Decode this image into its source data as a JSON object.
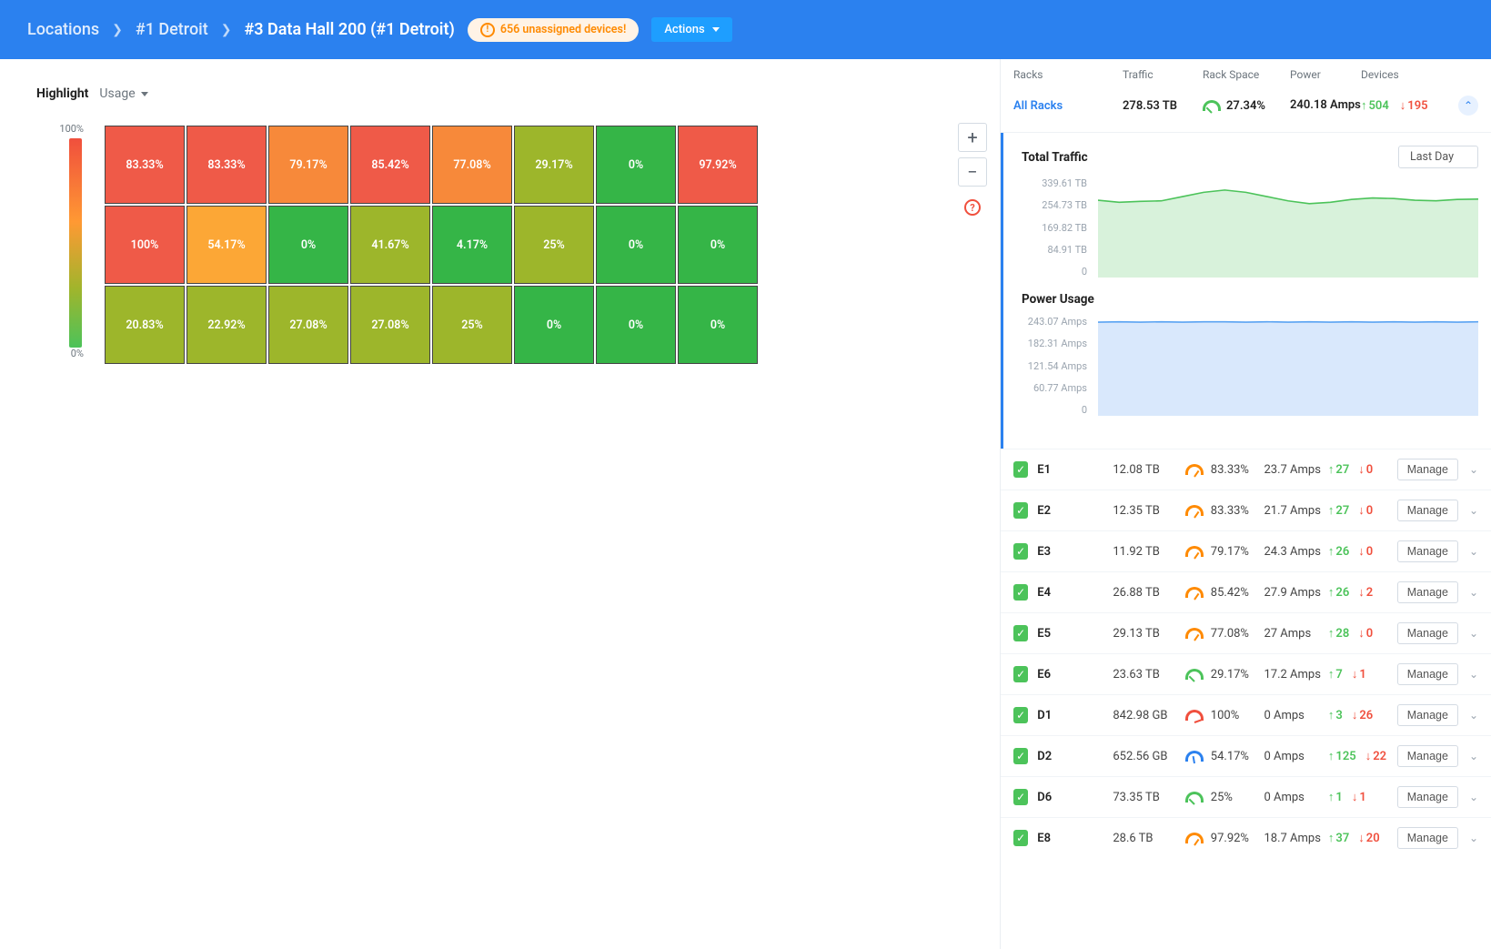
{
  "header": {
    "breadcrumbs": {
      "root": "Locations",
      "l1": "#1 Detroit",
      "current": "#3 Data Hall 200 (#1 Detroit)"
    },
    "unassigned_pill": "656 unassigned devices!",
    "actions_label": "Actions"
  },
  "highlight": {
    "label": "Highlight",
    "selected": "Usage"
  },
  "legend": {
    "top": "100%",
    "bottom": "0%"
  },
  "grid": [
    [
      {
        "v": "83.33%",
        "c": "#ef5a48"
      },
      {
        "v": "83.33%",
        "c": "#ef5a48"
      },
      {
        "v": "79.17%",
        "c": "#f7893a"
      },
      {
        "v": "85.42%",
        "c": "#ef5a48"
      },
      {
        "v": "77.08%",
        "c": "#f7893a"
      },
      {
        "v": "29.17%",
        "c": "#9db62b"
      },
      {
        "v": "0%",
        "c": "#35b547"
      },
      {
        "v": "97.92%",
        "c": "#ef5a48"
      }
    ],
    [
      {
        "v": "100%",
        "c": "#ef5a48"
      },
      {
        "v": "54.17%",
        "c": "#fca736"
      },
      {
        "v": "0%",
        "c": "#35b547"
      },
      {
        "v": "41.67%",
        "c": "#9db62b"
      },
      {
        "v": "4.17%",
        "c": "#35b547"
      },
      {
        "v": "25%",
        "c": "#9db62b"
      },
      {
        "v": "0%",
        "c": "#35b547"
      },
      {
        "v": "0%",
        "c": "#35b547"
      }
    ],
    [
      {
        "v": "20.83%",
        "c": "#9db62b"
      },
      {
        "v": "22.92%",
        "c": "#9db62b"
      },
      {
        "v": "27.08%",
        "c": "#9db62b"
      },
      {
        "v": "27.08%",
        "c": "#9db62b"
      },
      {
        "v": "25%",
        "c": "#9db62b"
      },
      {
        "v": "0%",
        "c": "#35b547"
      },
      {
        "v": "0%",
        "c": "#35b547"
      },
      {
        "v": "0%",
        "c": "#35b547"
      }
    ]
  ],
  "stat_headers": {
    "racks": "Racks",
    "traffic": "Traffic",
    "rack_space": "Rack Space",
    "power": "Power",
    "devices": "Devices"
  },
  "summary": {
    "label": "All Racks",
    "traffic": "278.53 TB",
    "space_pct": "27.34%",
    "power": "240.18 Amps",
    "dev_up": "504",
    "dev_down": "195"
  },
  "charts": {
    "traffic": {
      "title": "Total Traffic",
      "range": "Last Day",
      "ylabels": [
        "339.61 TB",
        "254.73 TB",
        "169.82 TB",
        "84.91 TB",
        "0"
      ]
    },
    "power": {
      "title": "Power Usage",
      "ylabels": [
        "243.07 Amps",
        "182.31 Amps",
        "121.54 Amps",
        "60.77 Amps",
        "0"
      ]
    }
  },
  "chart_data": [
    {
      "type": "area",
      "title": "Total Traffic",
      "xlabel": "",
      "ylabel": "",
      "ylim": [
        0,
        339.61
      ],
      "y_unit": "TB",
      "x_range_label": "Last Day",
      "values": [
        272,
        265,
        268,
        270,
        285,
        300,
        308,
        300,
        285,
        270,
        260,
        265,
        275,
        280,
        278,
        272,
        270,
        275,
        276
      ]
    },
    {
      "type": "area",
      "title": "Power Usage",
      "xlabel": "",
      "ylabel": "",
      "ylim": [
        0,
        243.07
      ],
      "y_unit": "Amps",
      "values": [
        236,
        237,
        236,
        237,
        236,
        237,
        237,
        236,
        237,
        236,
        237,
        236,
        237,
        236,
        237,
        236,
        237,
        236,
        237
      ]
    }
  ],
  "racks": [
    {
      "name": "E1",
      "traffic": "12.08 TB",
      "space": "83.33%",
      "g": "orange",
      "power": "23.7 Amps",
      "up": "27",
      "down": "0",
      "manage": "Manage"
    },
    {
      "name": "E2",
      "traffic": "12.35 TB",
      "space": "83.33%",
      "g": "orange",
      "power": "21.7 Amps",
      "up": "27",
      "down": "0",
      "manage": "Manage"
    },
    {
      "name": "E3",
      "traffic": "11.92 TB",
      "space": "79.17%",
      "g": "orange",
      "power": "24.3 Amps",
      "up": "26",
      "down": "0",
      "manage": "Manage"
    },
    {
      "name": "E4",
      "traffic": "26.88 TB",
      "space": "85.42%",
      "g": "orange",
      "power": "27.9 Amps",
      "up": "26",
      "down": "2",
      "manage": "Manage"
    },
    {
      "name": "E5",
      "traffic": "29.13 TB",
      "space": "77.08%",
      "g": "orange",
      "power": "27 Amps",
      "up": "28",
      "down": "0",
      "manage": "Manage"
    },
    {
      "name": "E6",
      "traffic": "23.63 TB",
      "space": "29.17%",
      "g": "green",
      "power": "17.2 Amps",
      "up": "7",
      "down": "1",
      "manage": "Manage"
    },
    {
      "name": "D1",
      "traffic": "842.98 GB",
      "space": "100%",
      "g": "red",
      "power": "0 Amps",
      "up": "3",
      "down": "26",
      "manage": "Manage"
    },
    {
      "name": "D2",
      "traffic": "652.56 GB",
      "space": "54.17%",
      "g": "blue",
      "power": "0 Amps",
      "up": "125",
      "down": "22",
      "manage": "Manage"
    },
    {
      "name": "D6",
      "traffic": "73.35 TB",
      "space": "25%",
      "g": "green",
      "power": "0 Amps",
      "up": "1",
      "down": "1",
      "manage": "Manage"
    },
    {
      "name": "E8",
      "traffic": "28.6 TB",
      "space": "97.92%",
      "g": "orange",
      "power": "18.7 Amps",
      "up": "37",
      "down": "20",
      "manage": "Manage"
    }
  ]
}
